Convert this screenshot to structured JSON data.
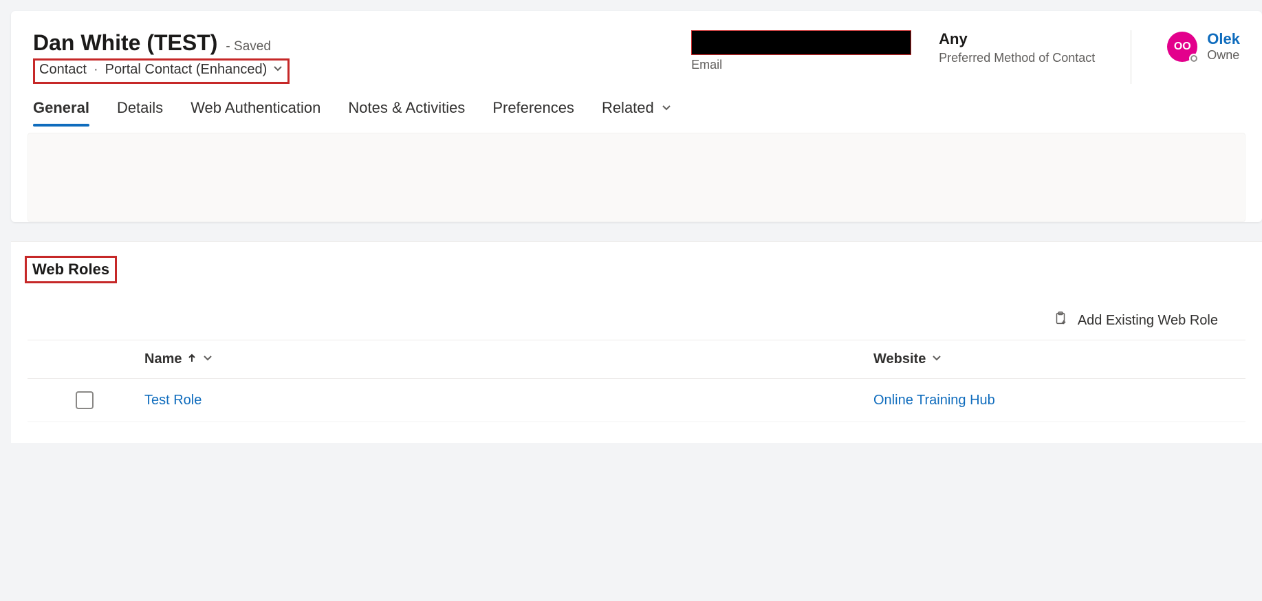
{
  "record": {
    "title": "Dan White (TEST)",
    "saved_suffix": "- Saved"
  },
  "breadcrumb": {
    "entity": "Contact",
    "sep": "·",
    "form": "Portal Contact (Enhanced)"
  },
  "header_fields": {
    "email": {
      "label": "Email"
    },
    "preferred_method": {
      "value": "Any",
      "label": "Preferred Method of Contact"
    },
    "owner": {
      "initials": "OO",
      "name": "Olek",
      "label": "Owne"
    }
  },
  "tabs": [
    {
      "label": "General",
      "active": true
    },
    {
      "label": "Details",
      "active": false
    },
    {
      "label": "Web Authentication",
      "active": false
    },
    {
      "label": "Notes & Activities",
      "active": false
    },
    {
      "label": "Preferences",
      "active": false
    },
    {
      "label": "Related",
      "active": false,
      "dropdown": true
    }
  ],
  "section": {
    "title": "Web Roles",
    "command": "Add Existing Web Role",
    "columns": {
      "name": "Name",
      "website": "Website"
    },
    "rows": [
      {
        "name": "Test Role",
        "website": "Online Training Hub"
      }
    ]
  }
}
